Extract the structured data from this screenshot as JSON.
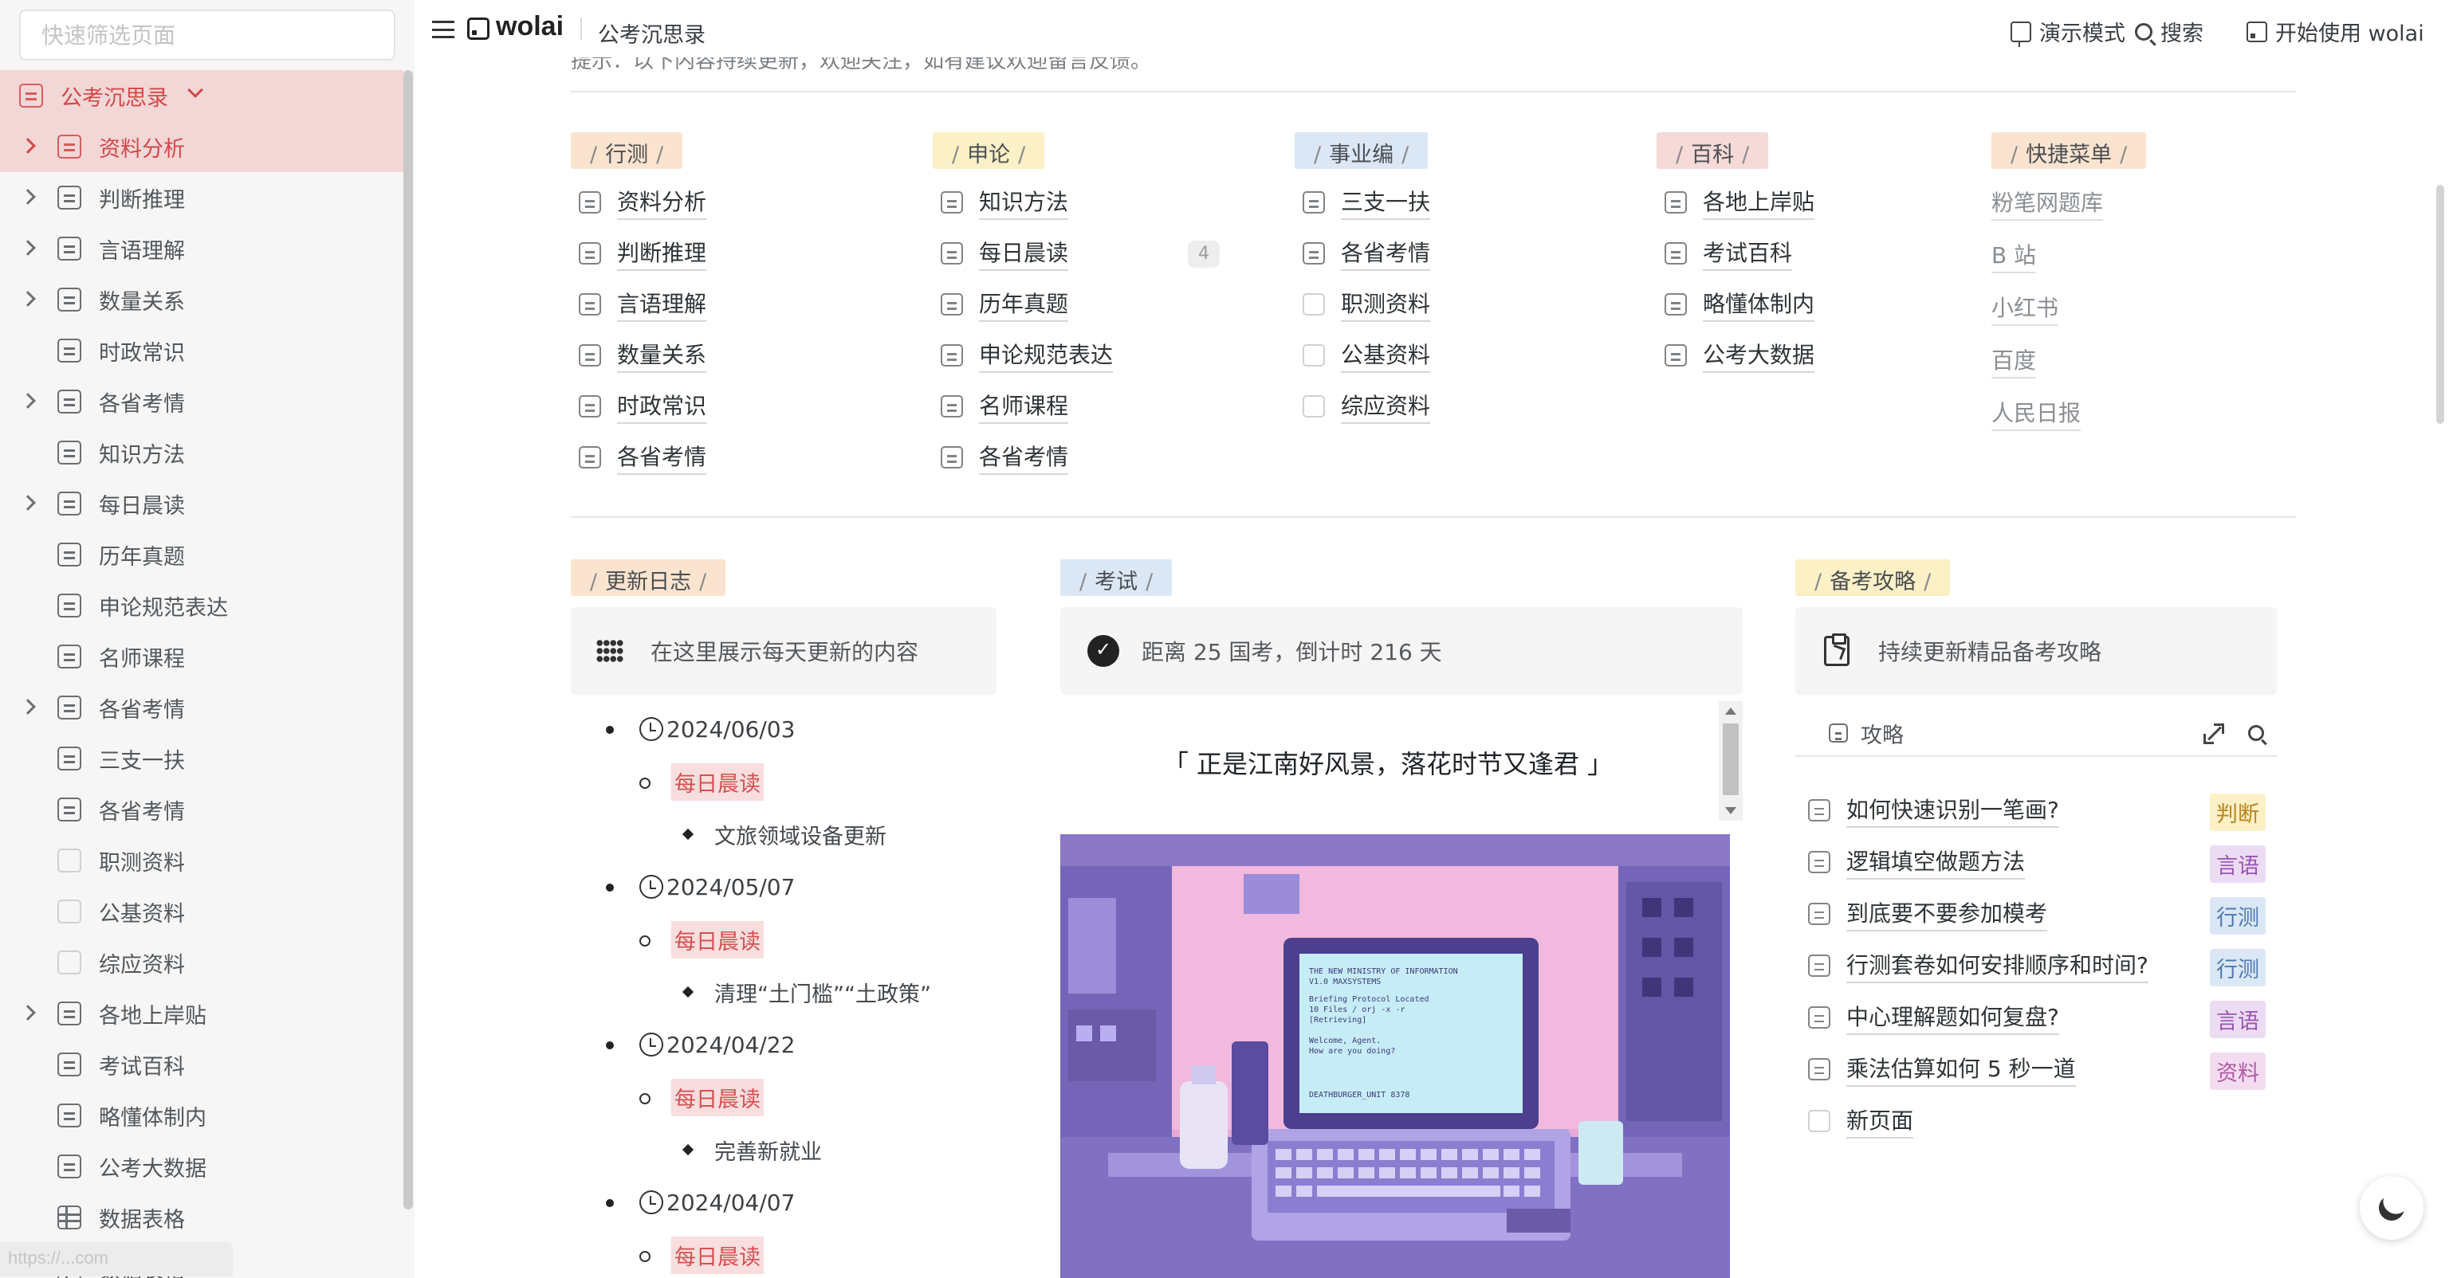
{
  "sidebar": {
    "filter_placeholder": "快速筛选页面",
    "url_hint": "https://...com",
    "items": [
      {
        "label": "公考沉思录",
        "level": "root",
        "icon": "page"
      },
      {
        "label": "资料分析",
        "expand": true,
        "active": true,
        "icon": "page"
      },
      {
        "label": "判断推理",
        "expand": true,
        "icon": "page"
      },
      {
        "label": "言语理解",
        "expand": true,
        "icon": "page"
      },
      {
        "label": "数量关系",
        "expand": true,
        "icon": "page"
      },
      {
        "label": "时政常识",
        "expand": false,
        "icon": "page"
      },
      {
        "label": "各省考情",
        "expand": true,
        "icon": "page"
      },
      {
        "label": "知识方法",
        "expand": false,
        "icon": "page"
      },
      {
        "label": "每日晨读",
        "expand": true,
        "icon": "page"
      },
      {
        "label": "历年真题",
        "expand": false,
        "icon": "page"
      },
      {
        "label": "申论规范表达",
        "expand": false,
        "icon": "page"
      },
      {
        "label": "名师课程",
        "expand": false,
        "icon": "page"
      },
      {
        "label": "各省考情",
        "expand": true,
        "icon": "page"
      },
      {
        "label": "三支一扶",
        "expand": false,
        "icon": "page"
      },
      {
        "label": "各省考情",
        "expand": false,
        "icon": "page"
      },
      {
        "label": "职测资料",
        "expand": false,
        "icon": "blank"
      },
      {
        "label": "公基资料",
        "expand": false,
        "icon": "blank"
      },
      {
        "label": "综应资料",
        "expand": false,
        "icon": "blank"
      },
      {
        "label": "各地上岸贴",
        "expand": true,
        "icon": "page"
      },
      {
        "label": "考试百科",
        "expand": false,
        "icon": "page"
      },
      {
        "label": "略懂体制内",
        "expand": false,
        "icon": "page"
      },
      {
        "label": "公考大数据",
        "expand": false,
        "icon": "page"
      },
      {
        "label": "数据表格",
        "expand": false,
        "icon": "table"
      },
      {
        "label": "数据表格",
        "expand": false,
        "icon": "table"
      }
    ]
  },
  "header": {
    "logo": "wolai",
    "breadcrumb": "公考沉思录",
    "present": "演示模式",
    "search": "搜索",
    "start": "开始使用 wolai"
  },
  "top_clip": "提示：以下内容持续更新，欢迎关注，如有建议欢迎留言反馈。",
  "sections": [
    {
      "tag": "行测",
      "color": "orange",
      "links": [
        "资料分析",
        "判断推理",
        "言语理解",
        "数量关系",
        "时政常识",
        "各省考情"
      ]
    },
    {
      "tag": "申论",
      "color": "yellow",
      "links": [
        "知识方法",
        "每日晨读",
        "历年真题",
        "申论规范表达",
        "名师课程",
        "各省考情"
      ],
      "badge": "4"
    },
    {
      "tag": "事业编",
      "color": "blue",
      "links": [
        "三支一扶",
        "各省考情",
        "职测资料",
        "公基资料",
        "综应资料"
      ]
    },
    {
      "tag": "百科",
      "color": "red",
      "links": [
        "各地上岸贴",
        "考试百科",
        "略懂体制内",
        "公考大数据"
      ]
    }
  ],
  "quick_menu": {
    "tag": "快捷菜单",
    "links": [
      "粉笔网题库",
      "B 站",
      "小红书",
      "百度",
      "人民日报"
    ]
  },
  "updates": {
    "tag": "更新日志",
    "callout": "在这里展示每天更新的内容",
    "entries": [
      {
        "date": "2024/06/03",
        "cat": "每日晨读",
        "item": "文旅领域设备更新"
      },
      {
        "date": "2024/05/07",
        "cat": "每日晨读",
        "item": "清理“土门槛”“土政策”"
      },
      {
        "date": "2024/04/22",
        "cat": "每日晨读",
        "item": "完善新就业"
      },
      {
        "date": "2024/04/07",
        "cat": "每日晨读",
        "item": ""
      }
    ]
  },
  "exam": {
    "tag": "考试",
    "callout": "距离 25 国考，倒计时 216 天",
    "quote": "「 正是江南好风景，落花时节又逢君 」",
    "screen_lines": [
      "THE NEW MINISTRY OF INFORMATION",
      "V1.0 MAXSYSTEMS",
      "Briefing Protocol Located",
      "10 Files / orj -x -r",
      "[Retrieving]",
      "Welcome, Agent.",
      "How are you doing?",
      "DEATHBURGER_UNIT 8378"
    ]
  },
  "strategy": {
    "tag": "备考攻略",
    "callout": "持续更新精品备考攻略",
    "db_title": "攻略",
    "rows": [
      {
        "title": "如何快速识别一笔画?",
        "tag": "判断",
        "tag_bg": "#fbf0c6",
        "tag_fg": "#b9851c"
      },
      {
        "title": "逻辑填空做题方法",
        "tag": "言语",
        "tag_bg": "#ecdcf3",
        "tag_fg": "#9a55b5"
      },
      {
        "title": "到底要不要参加模考",
        "tag": "行测",
        "tag_bg": "#dbe7f5",
        "tag_fg": "#4c7ab0"
      },
      {
        "title": "行测套卷如何安排顺序和时间?",
        "tag": "行测",
        "tag_bg": "#dbe7f5",
        "tag_fg": "#4c7ab0"
      },
      {
        "title": "中心理解题如何复盘?",
        "tag": "言语",
        "tag_bg": "#ecdcf3",
        "tag_fg": "#9a55b5"
      },
      {
        "title": "乘法估算如何 5 秒一道",
        "tag": "资料",
        "tag_bg": "#f3dcf0",
        "tag_fg": "#b05aa6"
      },
      {
        "title": "新页面",
        "tag": "",
        "tag_bg": "",
        "tag_fg": ""
      }
    ]
  }
}
